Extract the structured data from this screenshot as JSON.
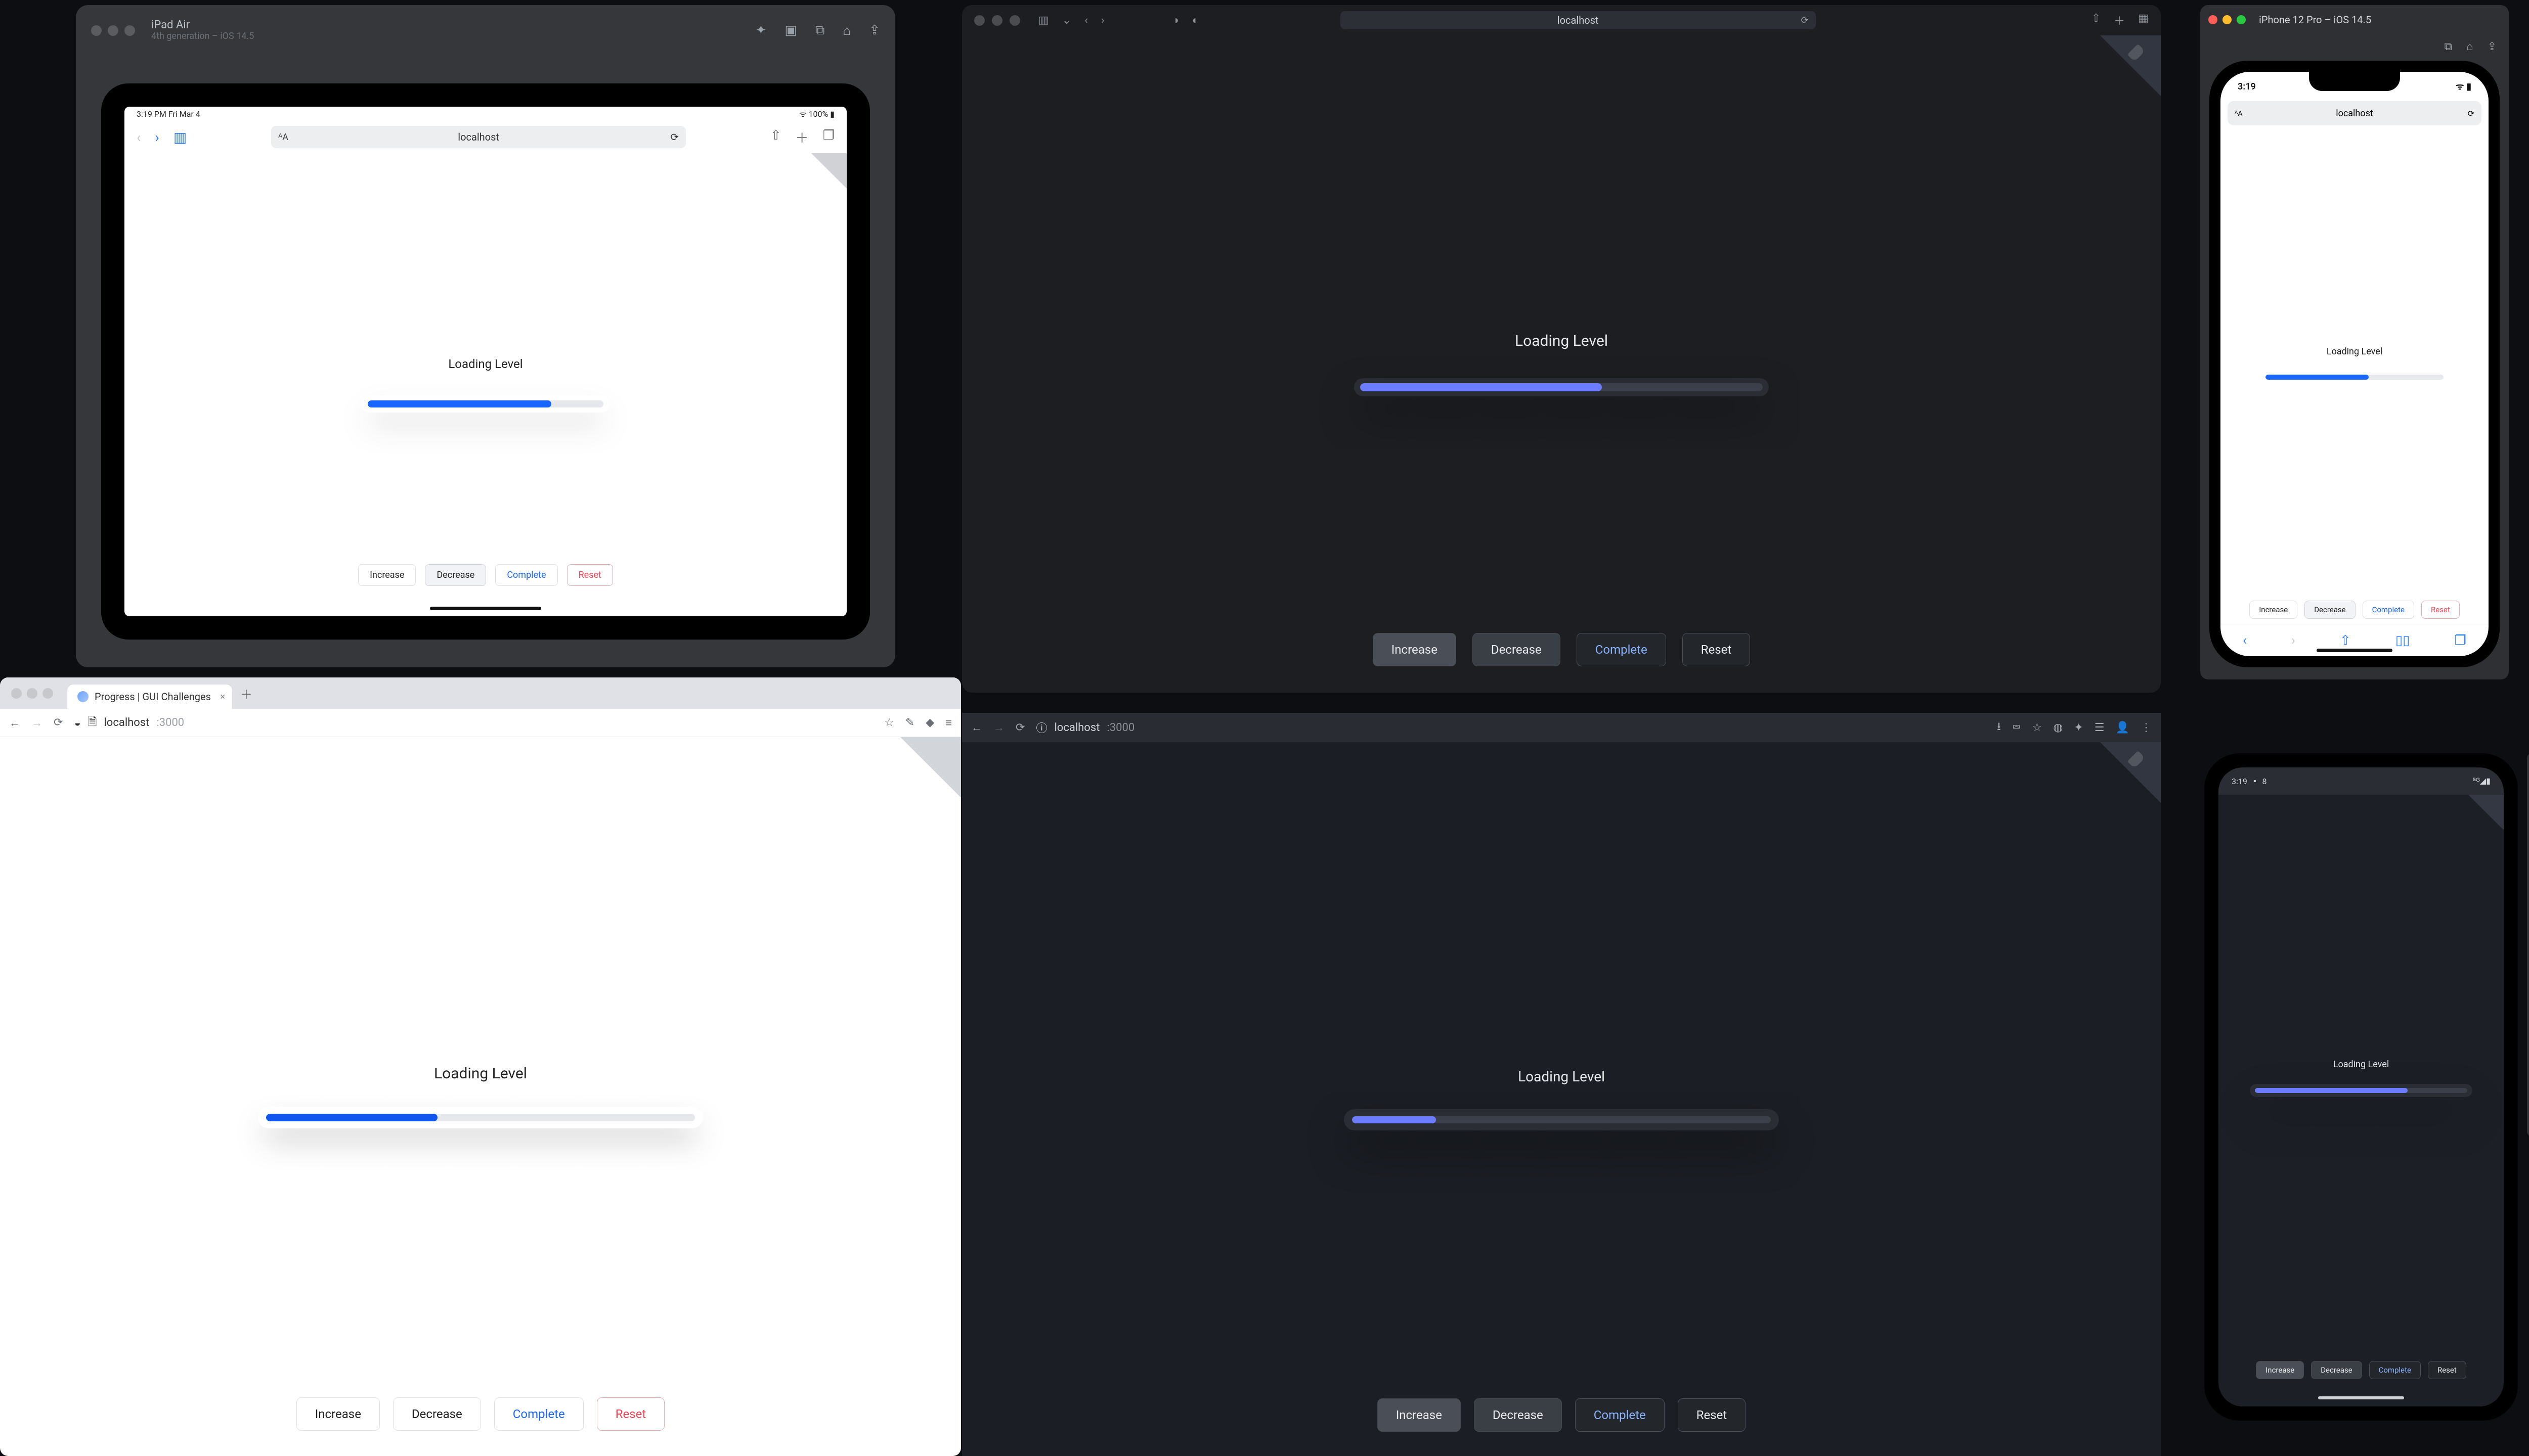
{
  "app": {
    "loading_label": "Loading Level",
    "buttons": {
      "increase": "Increase",
      "decrease": "Decrease",
      "complete": "Complete",
      "reset": "Reset"
    }
  },
  "ipad_sim": {
    "device": "iPad Air",
    "subtitle": "4th generation – iOS 14.5",
    "status_time": "3:19 PM  Fri Mar 4",
    "status_right": "100%",
    "addr": "localhost",
    "progress_pct": 78
  },
  "safari_dark": {
    "addr": "localhost",
    "progress_pct": 60
  },
  "iphone_sim": {
    "title": "iPhone 12 Pro – iOS 14.5",
    "status_time": "3:19",
    "addr": "localhost",
    "progress_pct": 58
  },
  "chrome_light": {
    "tab_title": "Progress | GUI Challenges",
    "host": "localhost",
    "port": ":3000",
    "progress_pct": 40
  },
  "chrome_dark": {
    "host": "localhost",
    "port": ":3000",
    "progress_pct": 20
  },
  "android": {
    "status_time": "3:19",
    "status_icon_label": "8",
    "progress_pct": 72
  }
}
